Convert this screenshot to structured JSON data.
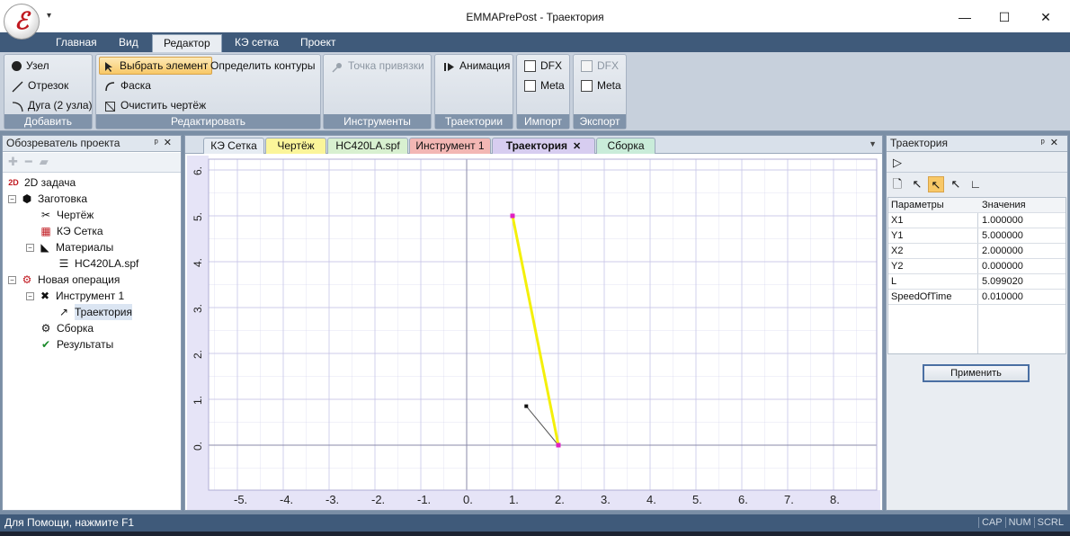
{
  "window": {
    "title": "EMMAPrePost - Траектория",
    "minimize_glyph": "—",
    "maximize_glyph": "☐",
    "close_glyph": "✕",
    "qat_glyph": "▾"
  },
  "ribbon_tabs": [
    "Главная",
    "Вид",
    "Редактор",
    "КЭ сетка",
    "Проект"
  ],
  "ribbon": {
    "add": {
      "label": "Добавить",
      "node": "Узел",
      "segment": "Отрезок",
      "arc": "Дуга (2 узла)"
    },
    "edit": {
      "label": "Редактировать",
      "select": "Выбрать элемент",
      "contours": "Определить контуры",
      "chamfer": "Фаска",
      "clear": "Очистить чертёж"
    },
    "tools": {
      "label": "Инструменты",
      "snap": "Точка привязки"
    },
    "traj": {
      "label": "Траектории",
      "animation": "Анимация"
    },
    "import": {
      "label": "Импорт",
      "dfx": "DFX",
      "meta": "Meta"
    },
    "export": {
      "label": "Экспорт",
      "dfx": "DFX",
      "meta": "Meta"
    }
  },
  "project_explorer": {
    "title": "Обозреватель проекта",
    "tree": [
      {
        "label": "2D задача",
        "icon": "2d-icon"
      },
      {
        "label": "Заготовка",
        "icon": "workpiece-icon"
      },
      {
        "label": "Чертёж",
        "icon": "drawing-icon"
      },
      {
        "label": "КЭ Сетка",
        "icon": "mesh-icon"
      },
      {
        "label": "Материалы",
        "icon": "materials-icon"
      },
      {
        "label": "HC420LA.spf",
        "icon": "file-icon"
      },
      {
        "label": "Новая операция",
        "icon": "operation-icon"
      },
      {
        "label": "Инструмент 1",
        "icon": "tool-icon"
      },
      {
        "label": "Траектория",
        "icon": "trajectory-icon"
      },
      {
        "label": "Сборка",
        "icon": "assembly-icon"
      },
      {
        "label": "Результаты",
        "icon": "results-icon"
      }
    ]
  },
  "doc_tabs": [
    "КЭ Сетка",
    "Чертёж",
    "HC420LA.spf",
    "Инструмент 1",
    "Траектория",
    "Сборка"
  ],
  "doc_tab_colors": [
    "#e6ecf3",
    "#fbf59a",
    "#d8f0d0",
    "#f3b7b4",
    "#d7cdf0",
    "#c9ecd9"
  ],
  "doc_tab_close": "✕",
  "doc_menu_glyph": "▼",
  "plot": {
    "x_ticks": [
      "-5.",
      "-4.",
      "-3.",
      "-2.",
      "-1.",
      "0.",
      "1.",
      "2.",
      "3.",
      "4.",
      "5.",
      "6.",
      "7.",
      "8."
    ],
    "y_ticks": [
      "6.",
      "5.",
      "4.",
      "3.",
      "2.",
      "1.",
      "0."
    ],
    "trajectory": {
      "x1": 1.0,
      "y1": 5.0,
      "x2": 2.0,
      "y2": 0.0,
      "color": "#f4f00a"
    },
    "secondary_segment": {
      "x1": 1.3,
      "y1": 0.85,
      "x2": 2.0,
      "y2": 0.0,
      "color": "#555555"
    },
    "grid_color": "#c8c6e8",
    "endpoint_color": "#e020c0"
  },
  "trajectory_panel": {
    "title": "Траектория",
    "headers": [
      "Параметры",
      "Значения"
    ],
    "rows": [
      [
        "X1",
        "1.000000"
      ],
      [
        "Y1",
        "5.000000"
      ],
      [
        "X2",
        "2.000000"
      ],
      [
        "Y2",
        "0.000000"
      ],
      [
        "L",
        "5.099020"
      ],
      [
        "SpeedOfTime",
        "0.010000"
      ]
    ],
    "apply": "Применить"
  },
  "status": {
    "text": "Для Помощи, нажмите F1",
    "indicators": [
      "CAP",
      "NUM",
      "SCRL"
    ]
  }
}
